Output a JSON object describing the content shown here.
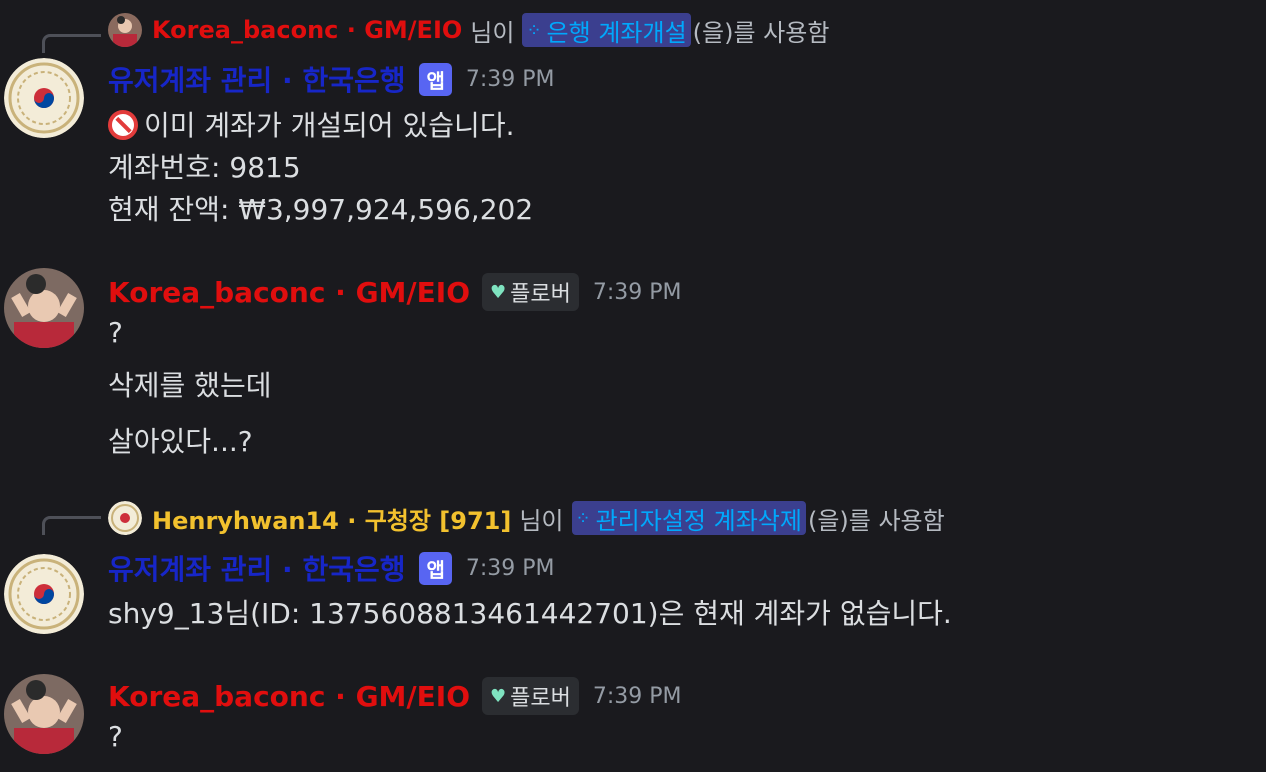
{
  "colors": {
    "background": "#1a1a1e",
    "bot_name": "#1726c7",
    "user_red": "#e00e0e",
    "user_yellow": "#f2c12e",
    "command_chip_bg": "#3b3f8f",
    "command_chip_text": "#00a8fc",
    "app_badge": "#5865f2"
  },
  "messages": [
    {
      "reply": {
        "user": "Korea_baconc · GM/EIO",
        "text_before": "님이",
        "command": "은행 계좌개설",
        "text_after": "(을)를 사용함",
        "avatar_icon": "user-photo-avatar"
      },
      "author": "유저계좌 관리 · 한국은행",
      "badge": "앱",
      "time": "7:39 PM",
      "avatar_icon": "korean-seal-avatar",
      "lines": [
        "이미 계좌가 개설되어 있습니다.",
        "계좌번호: 9815",
        "현재 잔액: ₩3,997,924,596,202"
      ],
      "emoji_icon": "prohibited-emoji"
    },
    {
      "author": "Korea_baconc · GM/EIO",
      "role": "플로버",
      "role_icon": "heart-icon",
      "time": "7:39 PM",
      "avatar_icon": "user-photo-avatar",
      "lines": [
        "?",
        "삭제를 했는데",
        "살아있다...?"
      ]
    },
    {
      "reply": {
        "user": "Henryhwan14 · 구청장 [971]",
        "text_before": "님이",
        "command": "관리자설정 계좌삭제",
        "text_after": "(을)를 사용함",
        "avatar_icon": "korean-seal-avatar"
      },
      "author": "유저계좌 관리 · 한국은행",
      "badge": "앱",
      "time": "7:39 PM",
      "avatar_icon": "korean-seal-avatar",
      "lines": [
        "shy9_13님(ID: 1375608813461442701)은 현재 계좌가 없습니다."
      ]
    },
    {
      "author": "Korea_baconc · GM/EIO",
      "role": "플로버",
      "role_icon": "heart-icon",
      "time": "7:39 PM",
      "avatar_icon": "user-photo-avatar",
      "lines": [
        "?"
      ]
    }
  ]
}
